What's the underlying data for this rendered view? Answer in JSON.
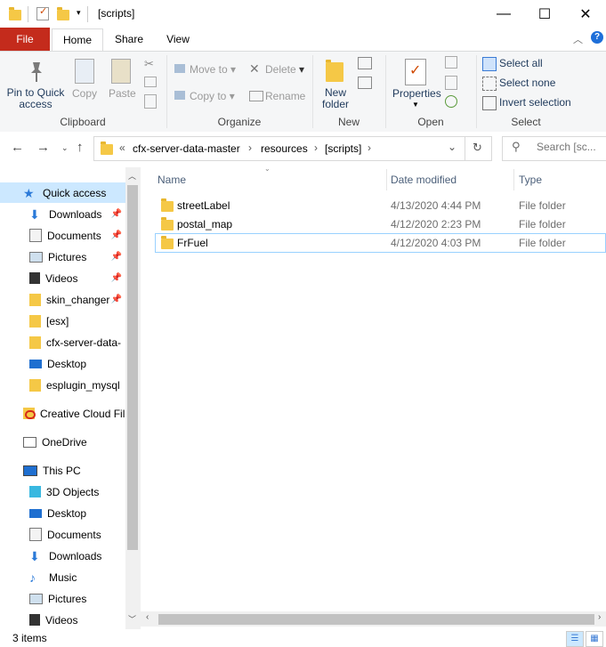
{
  "window": {
    "title": "[scripts]",
    "minimize": "—",
    "maximize": "☐",
    "close": "✕"
  },
  "ribbon_tabs": [
    "File",
    "Home",
    "Share",
    "View"
  ],
  "ribbon": {
    "clipboard": {
      "label": "Clipboard",
      "pin": "Pin to Quick access",
      "pin_l1": "Pin to Quick",
      "pin_l2": "access",
      "copy": "Copy",
      "paste": "Paste"
    },
    "organize": {
      "label": "Organize",
      "move_to": "Move to",
      "copy_to": "Copy to",
      "delete": "Delete",
      "rename": "Rename"
    },
    "new": {
      "label": "New",
      "new_folder_l1": "New",
      "new_folder_l2": "folder"
    },
    "open": {
      "label": "Open",
      "properties": "Properties"
    },
    "select": {
      "label": "Select",
      "select_all": "Select all",
      "select_none": "Select none",
      "invert": "Invert selection"
    }
  },
  "address": {
    "overflow": "«",
    "crumbs": [
      "cfx-server-data-master",
      "resources",
      "[scripts]"
    ],
    "sep": "›",
    "search_placeholder": "Search [sc..."
  },
  "nav": {
    "items": [
      {
        "label": "Quick access",
        "icon": "star-icon"
      },
      {
        "label": "Downloads",
        "icon": "download-icon",
        "pinned": true
      },
      {
        "label": "Documents",
        "icon": "documents-icon",
        "pinned": true
      },
      {
        "label": "Pictures",
        "icon": "pictures-icon",
        "pinned": true
      },
      {
        "label": "Videos",
        "icon": "videos-icon",
        "pinned": true
      },
      {
        "label": "skin_changer",
        "icon": "folder-icon",
        "pinned": true
      },
      {
        "label": "[esx]",
        "icon": "folder-icon"
      },
      {
        "label": "cfx-server-data-",
        "icon": "folder-icon"
      },
      {
        "label": "Desktop",
        "icon": "desktop-icon"
      },
      {
        "label": "esplugin_mysql",
        "icon": "folder-icon"
      },
      {
        "label": "Creative Cloud Fil",
        "icon": "creative-cloud-icon"
      },
      {
        "label": "OneDrive",
        "icon": "onedrive-icon"
      },
      {
        "label": "This PC",
        "icon": "pc-icon"
      },
      {
        "label": "3D Objects",
        "icon": "3d-objects-icon"
      },
      {
        "label": "Desktop",
        "icon": "desktop-icon"
      },
      {
        "label": "Documents",
        "icon": "documents-icon"
      },
      {
        "label": "Downloads",
        "icon": "download-icon"
      },
      {
        "label": "Music",
        "icon": "music-icon"
      },
      {
        "label": "Pictures",
        "icon": "pictures-icon"
      },
      {
        "label": "Videos",
        "icon": "videos-icon"
      }
    ]
  },
  "columns": {
    "name": "Name",
    "date": "Date modified",
    "type": "Type"
  },
  "files": [
    {
      "name": "streetLabel",
      "date": "4/13/2020 4:44 PM",
      "type": "File folder"
    },
    {
      "name": "postal_map",
      "date": "4/12/2020 2:23 PM",
      "type": "File folder"
    },
    {
      "name": "FrFuel",
      "date": "4/12/2020 4:03 PM",
      "type": "File folder"
    }
  ],
  "status": {
    "count": "3 items"
  },
  "colors": {
    "file_tab": "#c42b1c",
    "selected": "#cce8ff",
    "accent": "#0078d7"
  }
}
